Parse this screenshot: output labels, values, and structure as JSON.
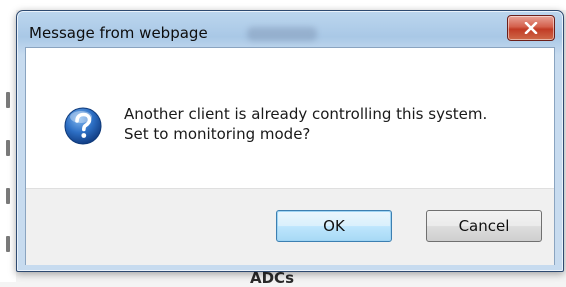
{
  "dialog": {
    "title": "Message from webpage",
    "message_line_1": "Another client is already controlling this system.",
    "message_line_2": "Set to monitoring mode?",
    "icon": "question-icon",
    "close_icon": "close-icon",
    "ok_label": "OK",
    "cancel_label": "Cancel"
  },
  "background": {
    "bottom_heading_fragment": "ADCs"
  },
  "colors": {
    "close_button": "#c13b25",
    "question_icon": "#1f5fb8",
    "ok_button_border": "#3c7fb1"
  }
}
